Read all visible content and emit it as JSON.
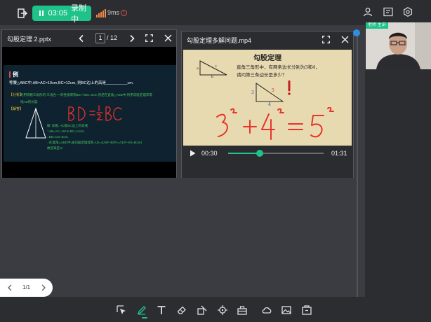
{
  "topbar": {
    "exit_icon": "exit-icon",
    "recording": {
      "time": "03:05",
      "label": "录制中",
      "pause_icon": "pause-icon"
    },
    "network": {
      "signal_icon": "signal-bars-icon",
      "latency": "9ms",
      "warn_icon": "warning-icon"
    },
    "right_icons": [
      "user-icon",
      "message-icon",
      "settings-icon"
    ]
  },
  "ppt_window": {
    "title": "勾股定理 2.pptx",
    "current_page": "1",
    "separator": "/",
    "total_pages": "12",
    "slide": {
      "heading": "例",
      "question": "等腰△ABC中,AB=AC=10cm,BC=12cm, 则BC边上的高是__________cm.",
      "analysis_tag": "【分析】",
      "analysis_text": "利用等腰三角形的“三线合一”的性质得到BD=½BC=6cm,然后在直角△ABD中,利用勾股定理求得",
      "analysis_text2": "线AD的长度.",
      "solution_tag": "【解答】",
      "sol1": "解: 如图, AD是BC边上的高线.",
      "sol2": "∵AB=AC=10cm,BC=12cm,",
      "sol3": "∴BD=CD=6cm,",
      "sol4": "∴在直角△ABD中,由勾股定理得到,AD=√(AB²−BD²)=√(10²−6²)=8(cm)",
      "sol5": "故答案是:8.",
      "handwriting": "BD=½BC"
    }
  },
  "video_window": {
    "title": "勾股定理多解问题.mp4",
    "frame": {
      "title": "勾股定理",
      "line1": "直角三角形中，有两条边长分别为3和4，",
      "line2": "请问第三条边长是多少？",
      "handwriting": "3²+4²=5²",
      "small_labels": [
        "a",
        "b",
        "c",
        "3",
        "4",
        "5"
      ]
    },
    "current_time": "00:30",
    "duration": "01:31",
    "progress": 0.33
  },
  "camera": {
    "label": "老师 主讲"
  },
  "pager": {
    "text": "1/1"
  },
  "toolbar": {
    "tools": [
      "select-tool-icon",
      "pen-tool-icon",
      "text-tool-icon",
      "eraser-tool-icon",
      "shape-tool-icon",
      "laser-pointer-icon",
      "toolbox-icon",
      "cloud-disk-icon",
      "image-icon",
      "courseware-icon"
    ],
    "active_color": "#1ec389"
  }
}
